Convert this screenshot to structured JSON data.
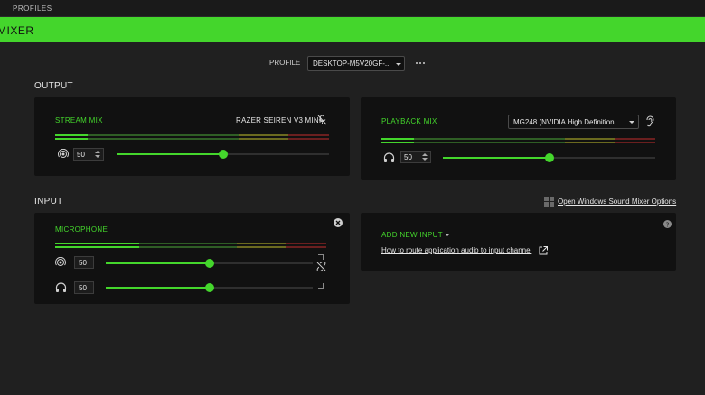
{
  "topbar": {
    "title": "PROFILES"
  },
  "header": {
    "title": "MIXER"
  },
  "profile": {
    "label": "PROFILE",
    "selected": "DESKTOP-M5V20GF-..."
  },
  "output": {
    "section_title": "OUTPUT",
    "stream_mix": {
      "title": "STREAM MIX",
      "device": "RAZER SEIREN V3 MINI",
      "meter_level": 0.12,
      "volume": "50",
      "volume_fraction": 0.5
    },
    "playback_mix": {
      "title": "PLAYBACK MIX",
      "device": "MG248 (NVIDIA High Definition...",
      "meter_level": 0.12,
      "volume": "50",
      "volume_fraction": 0.5
    }
  },
  "input": {
    "section_title": "INPUT",
    "windows_link": "Open Windows Sound Mixer Options",
    "microphone": {
      "title": "MICROPHONE",
      "meter_level": 0.31,
      "stream_volume": "50",
      "stream_fraction": 0.5,
      "monitor_volume": "50",
      "monitor_fraction": 0.5
    },
    "add_new": {
      "title": "ADD NEW INPUT",
      "route_link": "How to route application audio to input channel"
    }
  },
  "colors": {
    "accent": "#44d62c",
    "background": "#202020",
    "panel": "#111111",
    "meter_yellow": "#6b6a1f",
    "meter_red": "#6b1f1f"
  },
  "icons": {
    "more": "more-horizontal-icon",
    "mic_muted": "mic-muted-icon",
    "ear": "ear-icon",
    "broadcast": "broadcast-icon",
    "headphones": "headphones-icon",
    "close": "close-circle-icon",
    "unlink": "unlink-icon",
    "windows": "windows-logo-icon",
    "help": "help-circle-icon",
    "external_link": "external-link-icon"
  }
}
